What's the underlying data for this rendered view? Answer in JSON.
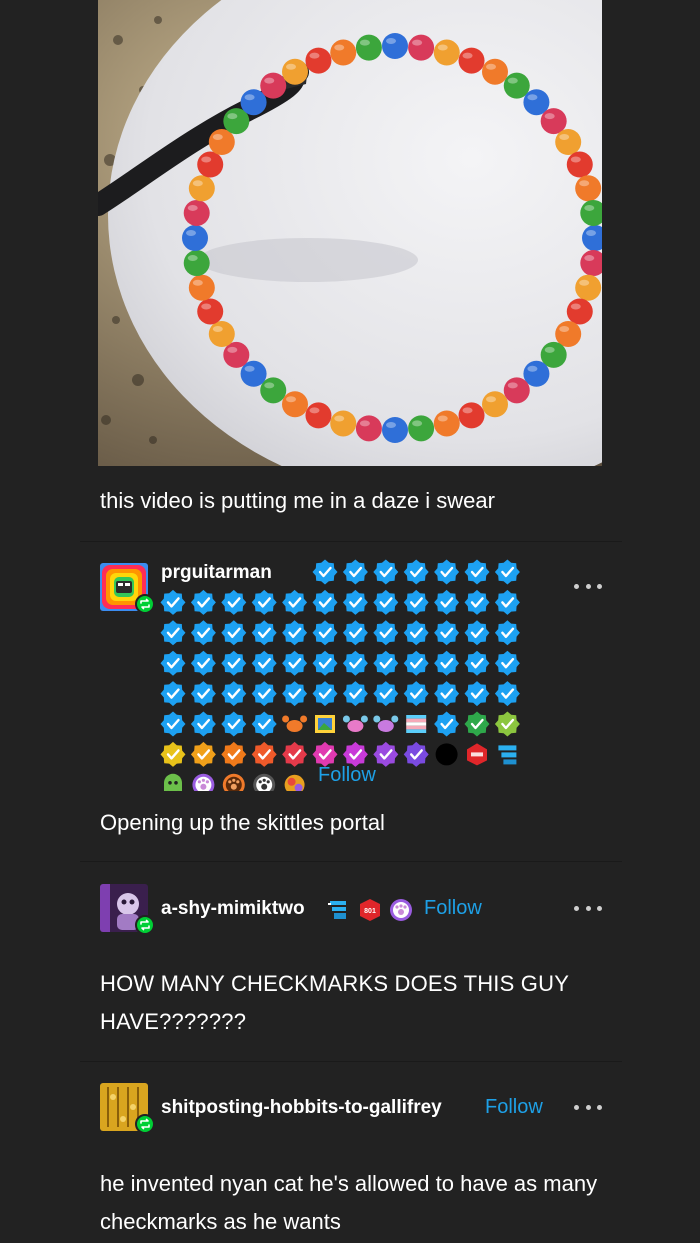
{
  "post": {
    "video_alt": "",
    "caption": "this video is putting me in a daze i swear"
  },
  "reblogs": [
    {
      "username": "prguitarman",
      "follow_label": "Follow",
      "verified_badge_count": 77,
      "text": "Opening up the skittles portal",
      "avatar_icon": "nyan-rainbow-avatar",
      "reblog_badge_color": "#00cf35"
    },
    {
      "username": "a-shy-mimiktwo",
      "follow_label": "Follow",
      "text": "HOW MANY CHECKMARKS DOES THIS GUY HAVE???????",
      "avatar_icon": "purple-character-avatar",
      "reblog_badge_color": "#00cf35"
    },
    {
      "username": "shitposting-hobbits-to-gallifrey",
      "follow_label": "Follow",
      "text": "he invented nyan cat he's allowed to have as many checkmarks as he wants",
      "avatar_icon": "yellow-pattern-avatar",
      "reblog_badge_color": "#00cf35"
    }
  ],
  "colors": {
    "background": "#222222",
    "link": "#1ea0e6",
    "verified": "#1da1f2",
    "text": "#ffffff"
  }
}
